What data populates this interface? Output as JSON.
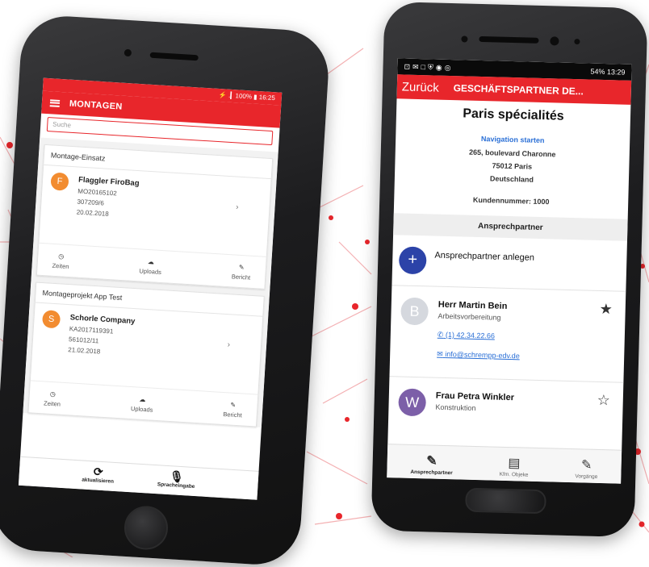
{
  "colors": {
    "accent": "#e8262b",
    "link": "#2a6fd6",
    "avatar_orange": "#f28c30",
    "add_button": "#2c43a8"
  },
  "left_phone": {
    "status_bar": "⚡ .▎100% ▮ 16:25",
    "title": "MONTAGEN",
    "search_placeholder": "Suche",
    "sections": [
      {
        "header": "Montage-Einsatz",
        "avatar": "F",
        "name": "Flaggler FiroBag",
        "lines": [
          "MO20165102",
          "307209/6",
          "20.02.2018"
        ],
        "actions": [
          {
            "icon": "clock-icon",
            "label": "Zeiten"
          },
          {
            "icon": "cloud-upload-icon",
            "label": "Uploads"
          },
          {
            "icon": "report-icon",
            "label": "Bericht"
          }
        ]
      },
      {
        "header": "Montageprojekt App Test",
        "avatar": "S",
        "name": "Schorle Company",
        "lines": [
          "KA2017119391",
          "561012/11",
          "21.02.2018"
        ],
        "actions": [
          {
            "icon": "clock-icon",
            "label": "Zeiten"
          },
          {
            "icon": "cloud-upload-icon",
            "label": "Uploads"
          },
          {
            "icon": "report-icon",
            "label": "Bericht"
          }
        ]
      }
    ],
    "footer": [
      {
        "icon": "refresh-icon",
        "label": "aktualisieren"
      },
      {
        "icon": "microphone-icon",
        "label": "Spracheingabe"
      }
    ]
  },
  "right_phone": {
    "status_time": "13:29",
    "status_battery": "54%",
    "back_label": "Zurück",
    "title": "GESCHÄFTSPARTNER DE...",
    "company": "Paris spécialités",
    "nav_link": "Navigation starten",
    "address": [
      "265, boulevard Charonne",
      "75012  Paris",
      "Deutschland"
    ],
    "customer_number": "Kundennummer: 1000",
    "section_title": "Ansprechpartner",
    "add_label": "Ansprechpartner anlegen",
    "contacts": [
      {
        "avatar": "B",
        "name": "Herr Martin Bein",
        "role": "Arbeitsvorbereitung",
        "phone": "(1) 42.34.22.66",
        "email": "info@schrempp-edv.de",
        "favorite": true
      },
      {
        "avatar": "W",
        "name": "Frau Petra Winkler",
        "role": "Konstruktion",
        "favorite": false
      }
    ],
    "tabs": [
      {
        "icon": "edit-icon",
        "label": "Ansprechpartner",
        "active": true
      },
      {
        "icon": "document-icon",
        "label": "Kfm. Objeke",
        "active": false
      },
      {
        "icon": "edit-icon",
        "label": "Vorgänge",
        "active": false
      }
    ]
  }
}
